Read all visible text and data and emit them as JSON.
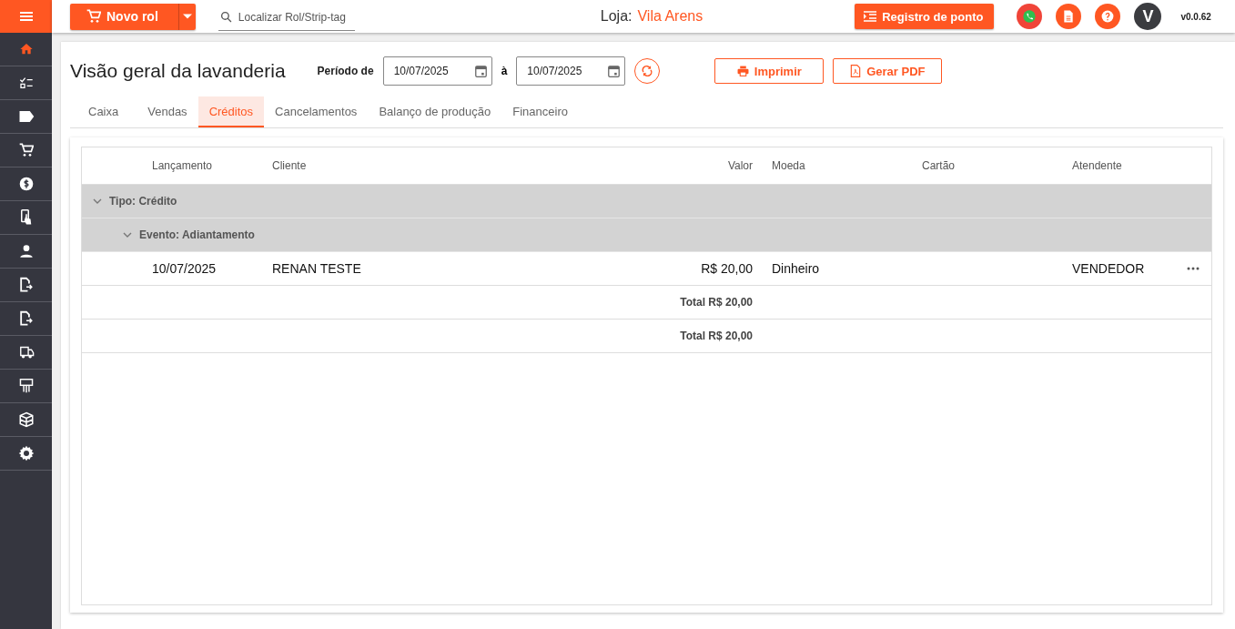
{
  "topbar": {
    "new_button": "Novo rol",
    "search": {
      "placeholder": "Localizar Rol/Strip-tag"
    },
    "store_label": "Loja:",
    "store_name": "Vila Arens",
    "clock_button": "Registro de ponto",
    "avatar": "V",
    "version": "v0.0.62"
  },
  "sidebar": {
    "items": [
      {
        "kind": "home",
        "selected": true
      },
      {
        "kind": "checklist",
        "selected": false
      },
      {
        "kind": "tag",
        "selected": false
      },
      {
        "kind": "cart",
        "selected": false
      },
      {
        "kind": "dollar",
        "selected": false
      },
      {
        "kind": "phone",
        "selected": false
      },
      {
        "kind": "person",
        "selected": false
      },
      {
        "kind": "export",
        "selected": false
      },
      {
        "kind": "export",
        "selected": false
      },
      {
        "kind": "truck",
        "selected": false
      },
      {
        "kind": "ticket",
        "selected": false
      },
      {
        "kind": "box",
        "selected": false
      },
      {
        "kind": "gear",
        "selected": false
      }
    ]
  },
  "page": {
    "title": "Visão geral da lavanderia",
    "period_label": "Período de",
    "date_from": "10/07/2025",
    "separator": "à",
    "date_to": "10/07/2025",
    "print_button": "Imprimir",
    "pdf_button": "Gerar PDF"
  },
  "tabs": [
    {
      "label": "Caixa",
      "selected": false
    },
    {
      "label": "Vendas",
      "selected": false
    },
    {
      "label": "Créditos",
      "selected": true
    },
    {
      "label": "Cancelamentos",
      "selected": false
    },
    {
      "label": "Balanço de produção",
      "selected": false
    },
    {
      "label": "Financeiro",
      "selected": false
    }
  ],
  "table": {
    "columns": [
      "Lançamento",
      "Cliente",
      "Valor",
      "Moeda",
      "Cartão",
      "Atendente"
    ],
    "group": {
      "label": "Tipo: Crédito",
      "expanded": true,
      "subgroup": {
        "label": "Evento: Adiantamento",
        "expanded": true,
        "rows": [
          {
            "date": "10/07/2025",
            "client": "RENAN TESTE",
            "value": "R$ 20,00",
            "currency": "Dinheiro",
            "card": "",
            "attendant": "VENDEDOR"
          }
        ],
        "total": "Total R$ 20,00"
      }
    },
    "grand_total": "Total R$ 20,00"
  }
}
